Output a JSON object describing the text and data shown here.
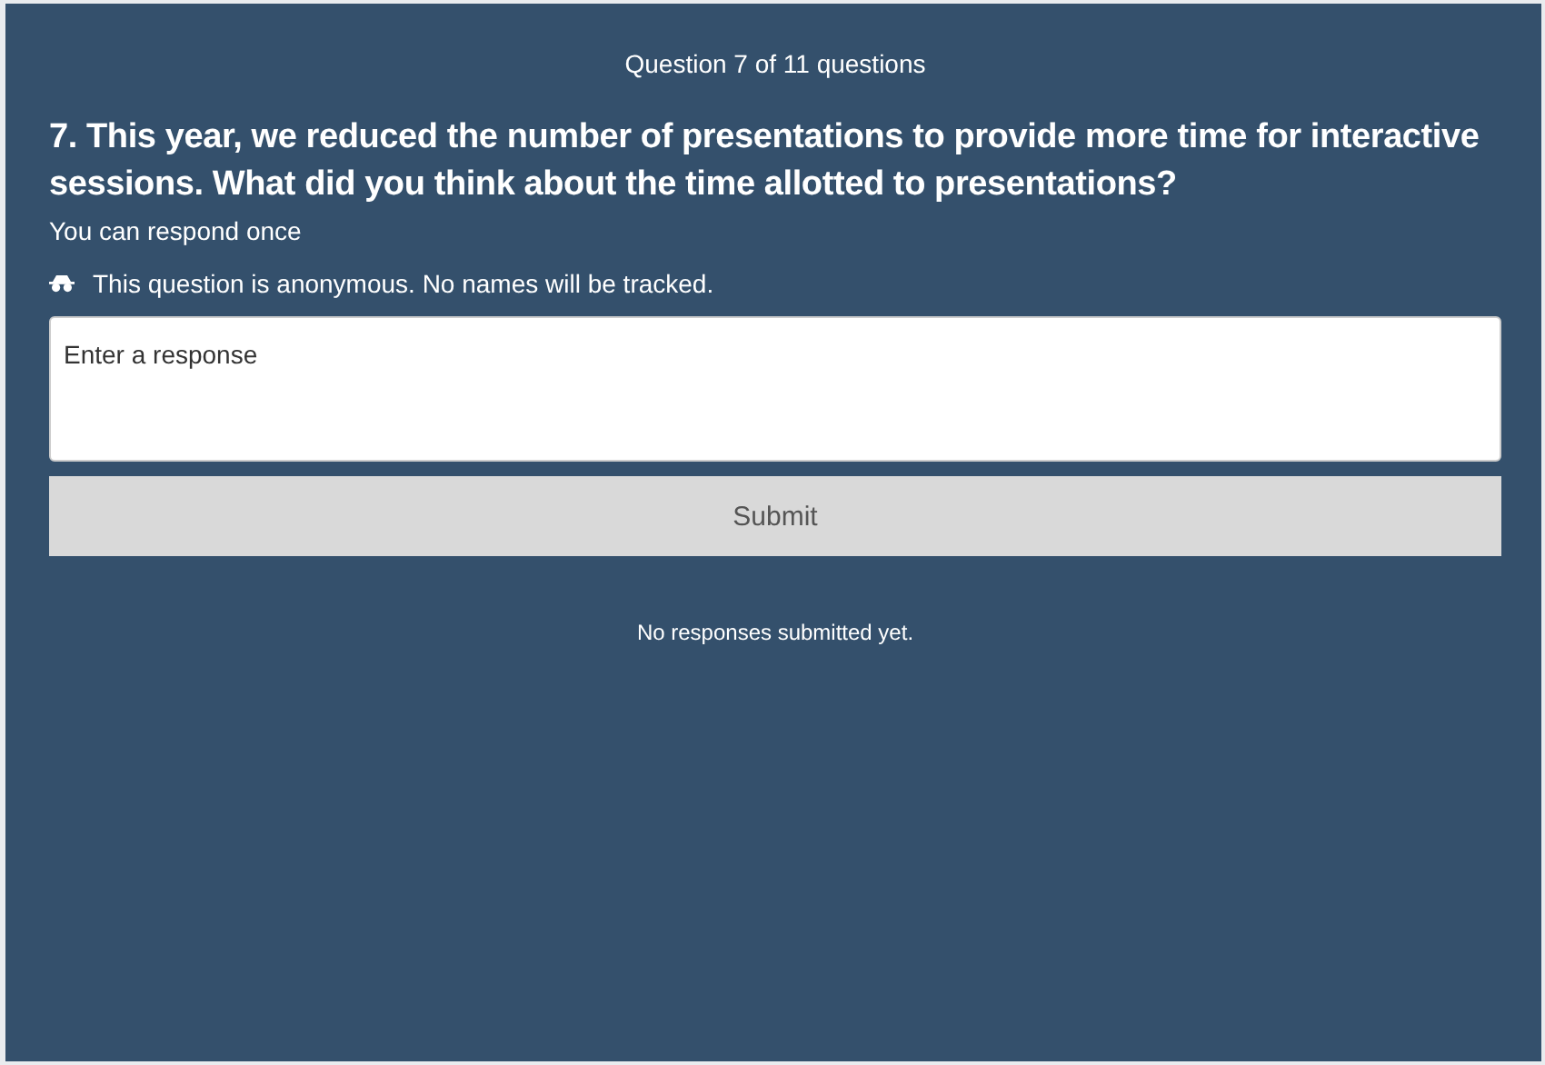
{
  "progress": "Question 7 of 11 questions",
  "question": "7. This year, we reduced the number of presentations to provide more time for interactive sessions. What did you think about the time allotted to presentations?",
  "response_limit": "You can respond once",
  "anonymous": {
    "on": true,
    "text": "This question is anonymous. No names will be tracked."
  },
  "response_field": {
    "placeholder": "Enter a response"
  },
  "submit_button": {
    "label": "Submit",
    "disabled": true
  },
  "status": "No responses submitted yet."
}
